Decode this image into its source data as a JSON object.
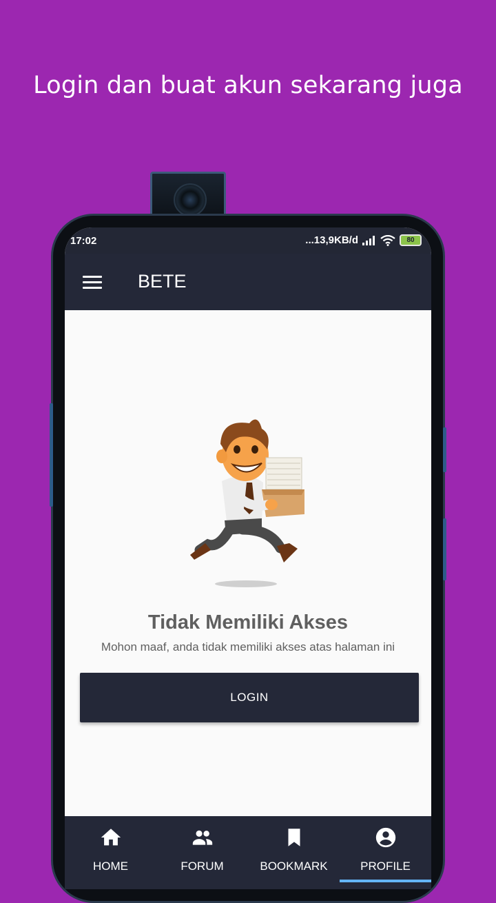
{
  "headline": "Login dan buat akun sekarang juga",
  "status_bar": {
    "time": "17:02",
    "network_speed": "...13,9KB/d",
    "battery": "80"
  },
  "app_bar": {
    "title": "BETE"
  },
  "empty_state": {
    "title": "Tidak Memiliki Akses",
    "message": "Mohon maaf, anda tidak memiliki akses atas halaman ini",
    "login_label": "LOGIN"
  },
  "bottom_nav": {
    "items": [
      {
        "label": "HOME",
        "icon": "home-icon"
      },
      {
        "label": "FORUM",
        "icon": "people-icon"
      },
      {
        "label": "BOOKMARK",
        "icon": "bookmark-icon"
      },
      {
        "label": "PROFILE",
        "icon": "account-circle-icon"
      }
    ],
    "active_index": 3
  },
  "colors": {
    "background": "#9C27B0",
    "app_bar": "#242838",
    "active_indicator": "#64B5F6"
  }
}
